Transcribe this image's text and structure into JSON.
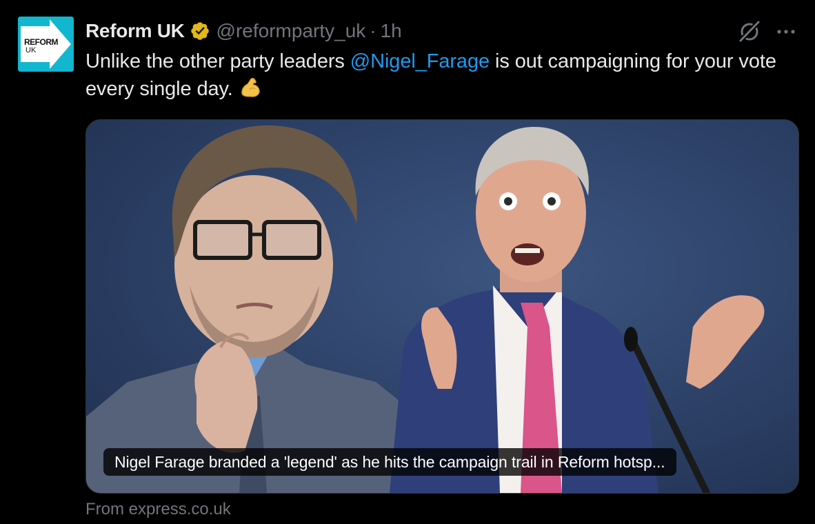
{
  "tweet": {
    "author": {
      "name": "Reform UK",
      "handle": "@reformparty_uk",
      "avatar_text_line1": "REFORM",
      "avatar_text_line2": "UK",
      "verified": "gold-verified-badge"
    },
    "separator": "·",
    "time": "1h",
    "text_part1": "Unlike the other party leaders ",
    "mention": "@Nigel_Farage",
    "text_part2": " is out campaigning for your vote every single day.",
    "emoji": "flexed-biceps",
    "card": {
      "caption": "Nigel Farage branded a 'legend' as he hits the campaign trail in Reform hotsp...",
      "source": "From express.co.uk"
    }
  },
  "icons": {
    "grok": "grok-icon",
    "more": "more-icon"
  },
  "colors": {
    "background": "#000000",
    "text": "#e7e9ea",
    "secondary": "#71767b",
    "link": "#1d9bf0",
    "verified_gold": "#e2b719",
    "reform_cyan": "#12b6cf"
  }
}
